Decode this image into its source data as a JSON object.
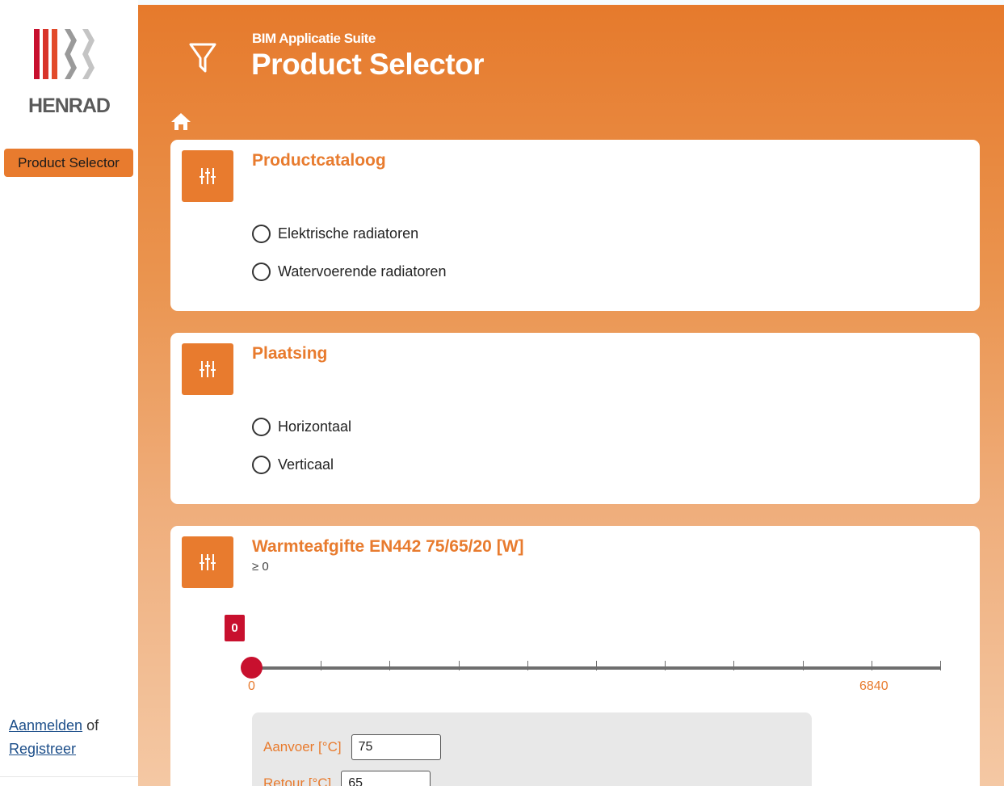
{
  "brand": {
    "name": "HENRAD",
    "stripe_colors": [
      "#c8102e",
      "#d8342a",
      "#e24a2a",
      "#9a9a9a",
      "#c4c4c4"
    ]
  },
  "sidebar": {
    "nav_item": "Product Selector",
    "auth": {
      "login": "Aanmelden",
      "or": " of",
      "register": "Registreer"
    }
  },
  "header": {
    "suite": "BIM Applicatie Suite",
    "title": "Product Selector"
  },
  "icons": {
    "filter": "funnel-icon",
    "home": "home-icon",
    "settings": "sliders-icon"
  },
  "cards": {
    "catalog": {
      "title": "Productcataloog",
      "options": [
        "Elektrische radiatoren",
        "Watervoerende radiatoren"
      ]
    },
    "placement": {
      "title": "Plaatsing",
      "options": [
        "Horizontaal",
        "Verticaal"
      ]
    },
    "output": {
      "title": "Warmteafgifte EN442 75/65/20 [W]",
      "subtitle": "≥ 0",
      "slider": {
        "value": "0",
        "min_label": "0",
        "max_label": "6840",
        "min": 0,
        "max": 6840,
        "current": 0,
        "tick_count": 10
      },
      "supply": {
        "label": "Aanvoer [°C]",
        "value": "75"
      },
      "return": {
        "label": "Retour [°C]",
        "value": "65"
      }
    }
  },
  "colors": {
    "accent": "#e87b2e",
    "slider_thumb": "#c8102e",
    "link": "#1d4f8a"
  }
}
